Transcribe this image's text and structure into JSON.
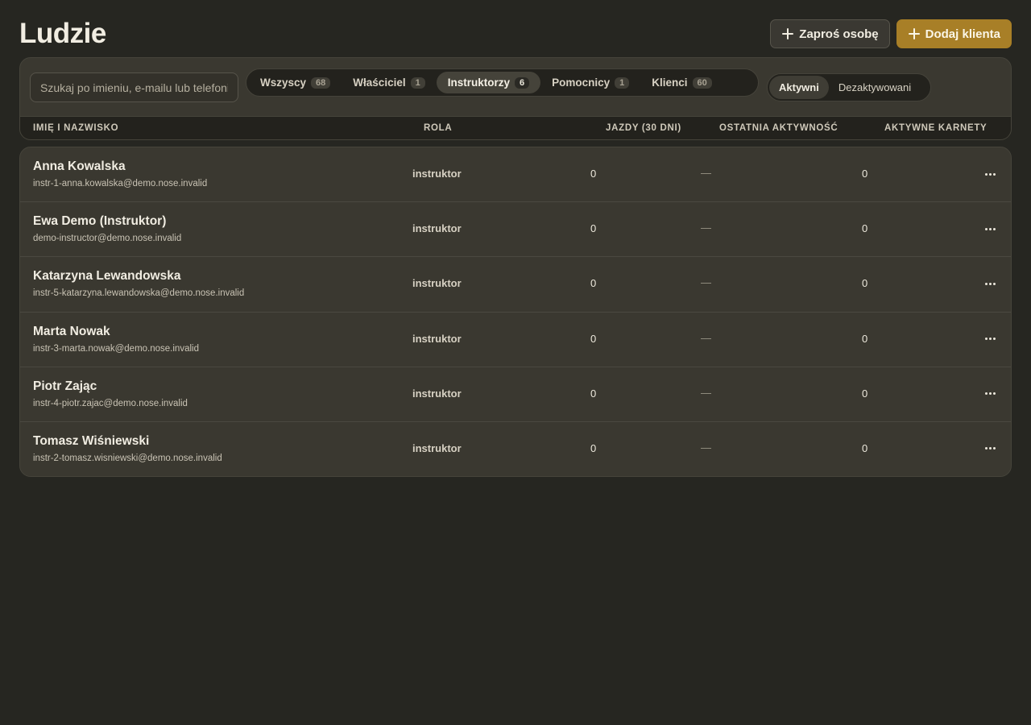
{
  "header": {
    "title": "Ludzie",
    "invite_label": "Zaproś osobę",
    "add_client_label": "Dodaj klienta"
  },
  "filters": {
    "search_placeholder": "Szukaj po imieniu, e-mailu lub telefonie",
    "role_tabs": [
      {
        "label": "Wszyscy",
        "count": "68",
        "active": false
      },
      {
        "label": "Właściciel",
        "count": "1",
        "active": false
      },
      {
        "label": "Instruktorzy",
        "count": "6",
        "active": true
      },
      {
        "label": "Pomocnicy",
        "count": "1",
        "active": false
      },
      {
        "label": "Klienci",
        "count": "60",
        "active": false
      }
    ],
    "status_tabs": [
      {
        "label": "Aktywni",
        "active": true
      },
      {
        "label": "Dezaktywowani",
        "active": false
      }
    ]
  },
  "columns": {
    "name": "IMIĘ I NAZWISKO",
    "role": "ROLA",
    "rides": "JAZDY (30 DNI)",
    "last_activity": "OSTATNIA AKTYWNOŚĆ",
    "passes": "AKTYWNE KARNETY"
  },
  "rows": [
    {
      "name": "Anna Kowalska",
      "email": "instr-1-anna.kowalska@demo.nose.invalid",
      "role": "instruktor",
      "rides": "0",
      "last_activity": "—",
      "passes": "0"
    },
    {
      "name": "Ewa Demo (Instruktor)",
      "email": "demo-instructor@demo.nose.invalid",
      "role": "instruktor",
      "rides": "0",
      "last_activity": "—",
      "passes": "0"
    },
    {
      "name": "Katarzyna Lewandowska",
      "email": "instr-5-katarzyna.lewandowska@demo.nose.invalid",
      "role": "instruktor",
      "rides": "0",
      "last_activity": "—",
      "passes": "0"
    },
    {
      "name": "Marta Nowak",
      "email": "instr-3-marta.nowak@demo.nose.invalid",
      "role": "instruktor",
      "rides": "0",
      "last_activity": "—",
      "passes": "0"
    },
    {
      "name": "Piotr Zając",
      "email": "instr-4-piotr.zajac@demo.nose.invalid",
      "role": "instruktor",
      "rides": "0",
      "last_activity": "—",
      "passes": "0"
    },
    {
      "name": "Tomasz Wiśniewski",
      "email": "instr-2-tomasz.wisniewski@demo.nose.invalid",
      "role": "instruktor",
      "rides": "0",
      "last_activity": "—",
      "passes": "0"
    }
  ],
  "icons": {
    "plus": "plus-icon",
    "more": "more-horizontal-icon"
  },
  "colors": {
    "background": "#262621",
    "panel": "#3a3830",
    "accent": "#a87f27"
  }
}
